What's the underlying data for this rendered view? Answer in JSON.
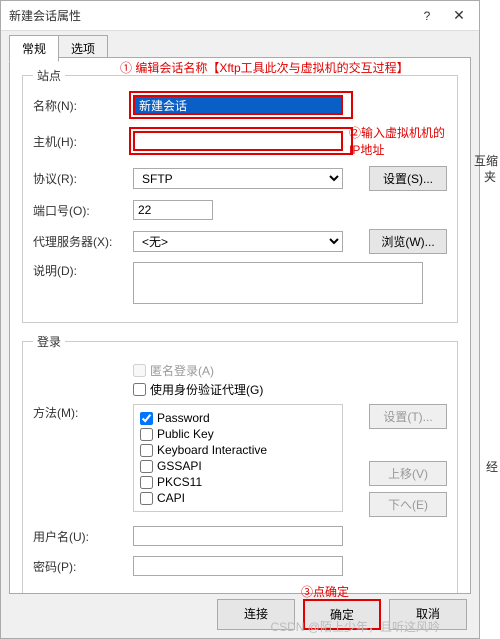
{
  "window": {
    "title": "新建会话属性"
  },
  "tabs": {
    "t0": "常规",
    "t1": "选项"
  },
  "site": {
    "legend": "站点",
    "name_label": "名称(N):",
    "name_value": "新建会话",
    "host_label": "主机(H):",
    "host_value": "",
    "proto_label": "协议(R):",
    "proto_value": "SFTP",
    "proto_btn": "设置(S)...",
    "port_label": "端口号(O):",
    "port_value": "22",
    "proxy_label": "代理服务器(X):",
    "proxy_value": "<无>",
    "proxy_btn": "浏览(W)...",
    "desc_label": "说明(D):"
  },
  "login": {
    "legend": "登录",
    "anon": "匿名登录(A)",
    "useagent": "使用身份验证代理(G)",
    "method_label": "方法(M):",
    "m0": "Password",
    "m1": "Public Key",
    "m2": "Keyboard Interactive",
    "m3": "GSSAPI",
    "m4": "PKCS11",
    "m5": "CAPI",
    "btn_set": "设置(T)...",
    "btn_up": "上移(V)",
    "btn_down": "下へ(E)",
    "user_label": "用户名(U):",
    "pass_label": "密码(P):"
  },
  "buttons": {
    "connect": "连接",
    "ok": "确定",
    "cancel": "取消"
  },
  "annotations": {
    "a1": "① 编辑会话名称【Xftp工具此次与虚拟机的交互过程】",
    "a2": "②输入虚拟机机的IP地址",
    "a3": "③点确定"
  },
  "side": {
    "s1": "互缩",
    "s2": "夹",
    "s3": "经"
  },
  "watermark": "CSDN @陌上少年，且听这风吟"
}
